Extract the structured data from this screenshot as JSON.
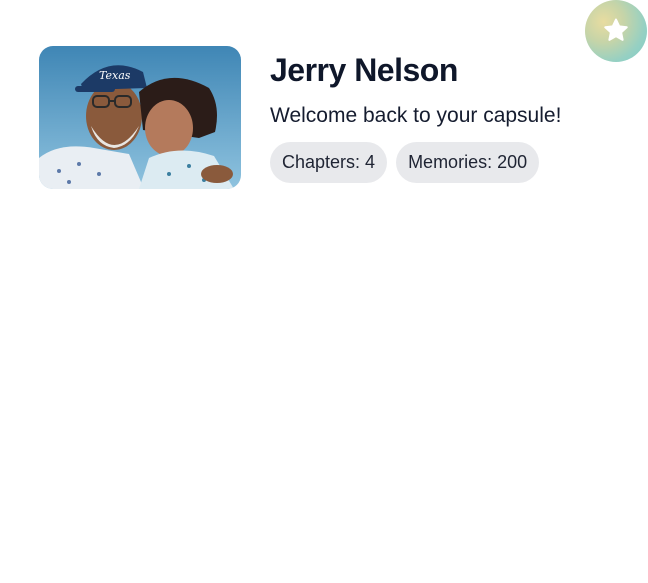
{
  "profile": {
    "name": "Jerry Nelson",
    "welcome": "Welcome back to your capsule!",
    "photo_icon": "profile-photo",
    "stats": {
      "chapters": "Chapters: 4",
      "memories": "Memories: 200"
    }
  },
  "favorite_button": {
    "icon": "star-icon"
  },
  "colors": {
    "chip_background": "#e8e9ec",
    "name_text": "#0f172a",
    "fab_gradient_start": "#e8dca0",
    "fab_gradient_end": "#7fcbc7"
  }
}
